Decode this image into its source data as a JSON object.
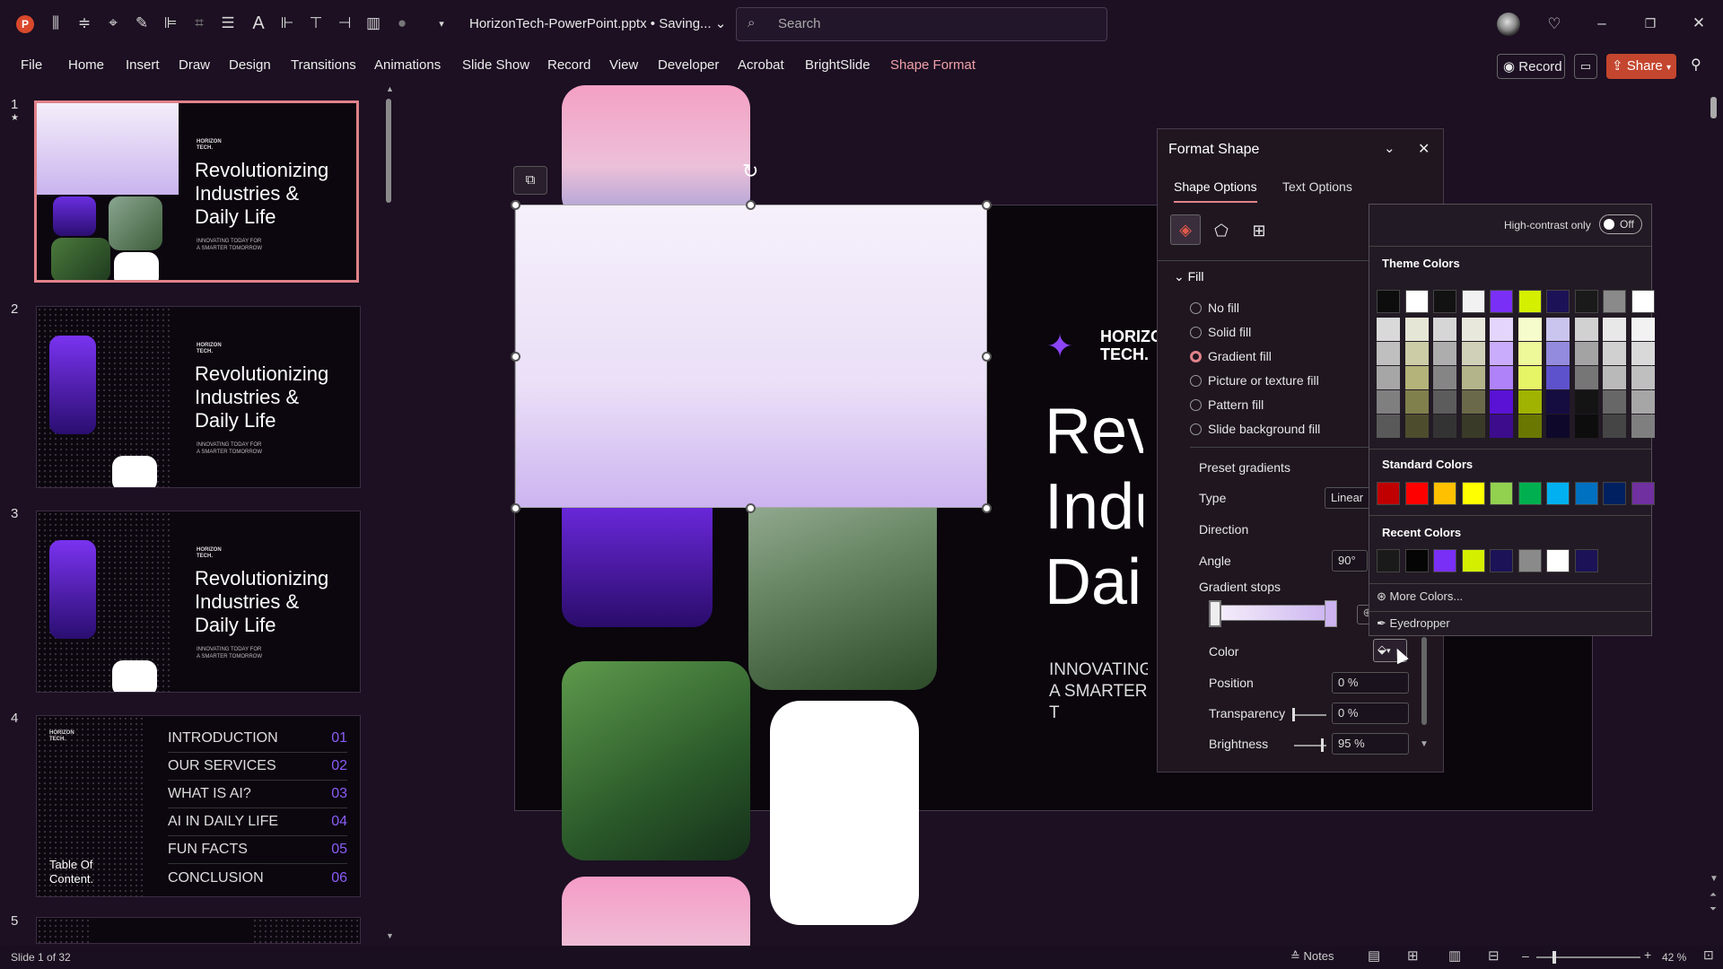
{
  "app": {
    "filename": "HorizonTech-PowerPoint.pptx",
    "status": "Saving...",
    "search_placeholder": "Search"
  },
  "ribbon_tabs": [
    "File",
    "Home",
    "Insert",
    "Draw",
    "Design",
    "Transitions",
    "Animations",
    "Slide Show",
    "Record",
    "View",
    "Developer",
    "Acrobat",
    "BrightSlide",
    "Shape Format"
  ],
  "active_tab": "Shape Format",
  "right_buttons": {
    "record": "Record",
    "share": "Share"
  },
  "thumbs": [
    {
      "num": "1",
      "title": "Revolutionizing\nIndustries &\nDaily Life",
      "sub": "INNOVATING TODAY FOR\nA SMARTER TOMORROW",
      "logo": "HORIZON\nTECH."
    },
    {
      "num": "2",
      "title": "Revolutionizing\nIndustries &\nDaily Life",
      "sub": "INNOVATING TODAY FOR\nA SMARTER TOMORROW",
      "logo": "HORIZON\nTECH."
    },
    {
      "num": "3",
      "title": "Revolutionizing\nIndustries &\nDaily Life",
      "sub": "INNOVATING TODAY FOR\nA SMARTER TOMORROW",
      "logo": "HORIZON\nTECH."
    }
  ],
  "toc": {
    "num": "4",
    "logo": "HORIZON\nTECH.",
    "label": "Table Of\nContent.",
    "items": [
      {
        "title": "INTRODUCTION",
        "n": "01"
      },
      {
        "title": "OUR SERVICES",
        "n": "02"
      },
      {
        "title": "WHAT IS AI?",
        "n": "03"
      },
      {
        "title": "AI IN DAILY LIFE",
        "n": "04"
      },
      {
        "title": "FUN FACTS",
        "n": "05"
      },
      {
        "title": "CONCLUSION",
        "n": "06"
      }
    ]
  },
  "thumb5": {
    "num": "5"
  },
  "slide": {
    "logo": "HORIZO\nTECH.",
    "title": "Revo\nIndu\nDaily",
    "sub": "INNOVATING\nA SMARTER T"
  },
  "format_shape": {
    "title": "Format Shape",
    "tab_shape": "Shape Options",
    "tab_text": "Text Options",
    "fill_header": "Fill",
    "fill_options": [
      "No fill",
      "Solid fill",
      "Gradient fill",
      "Picture or texture fill",
      "Pattern fill",
      "Slide background fill"
    ],
    "selected_fill": "Gradient fill",
    "preset_gradients": "Preset gradients",
    "type_label": "Type",
    "type_value": "Linear",
    "direction_label": "Direction",
    "angle_label": "Angle",
    "angle_value": "90°",
    "stops_label": "Gradient stops",
    "color_label": "Color",
    "position_label": "Position",
    "position_value": "0 %",
    "transparency_label": "Transparency",
    "transparency_value": "0 %",
    "brightness_label": "Brightness",
    "brightness_value": "95 %"
  },
  "color_popup": {
    "high_contrast": "High-contrast only",
    "toggle": "Off",
    "theme_header": "Theme Colors",
    "theme_top": [
      "#0d0d0d",
      "#ffffff",
      "#121212",
      "#f2f2f2",
      "#7a2ff7",
      "#d4ef00",
      "#1c1257",
      "#1a1a1a",
      "#8a8a8a",
      "#ffffff"
    ],
    "theme_shades": [
      [
        "#d9d9d9",
        "#bfbfbf",
        "#a6a6a6",
        "#7f7f7f",
        "#595959"
      ],
      [
        "#e6e6d6",
        "#cccca6",
        "#b3b37a",
        "#80804d",
        "#4d4d2e"
      ],
      [
        "#d6d6d6",
        "#adadad",
        "#858585",
        "#5c5c5c",
        "#333333"
      ],
      [
        "#e8e8dc",
        "#d0d0b8",
        "#b4b48a",
        "#6a6a4a",
        "#3a3a28"
      ],
      [
        "#e4d5fd",
        "#c9acfc",
        "#af82fa",
        "#5a12d4",
        "#3c0c8d"
      ],
      [
        "#f6fccc",
        "#eef999",
        "#e5f566",
        "#9fb300",
        "#6a7700"
      ],
      [
        "#c9c5ee",
        "#938bdd",
        "#5d52cc",
        "#150d40",
        "#0e092a"
      ],
      [
        "#d1d1d1",
        "#a3a3a3",
        "#767676",
        "#141414",
        "#0d0d0d"
      ],
      [
        "#e8e8e8",
        "#d0d0d0",
        "#b9b9b9",
        "#676767",
        "#454545"
      ],
      [
        "#f2f2f2",
        "#d9d9d9",
        "#bfbfbf",
        "#a6a6a6",
        "#7f7f7f"
      ]
    ],
    "standard_header": "Standard Colors",
    "standard": [
      "#c00000",
      "#ff0000",
      "#ffc000",
      "#ffff00",
      "#92d050",
      "#00b050",
      "#00b0f0",
      "#0070c0",
      "#002060",
      "#7030a0"
    ],
    "recent_header": "Recent Colors",
    "recent": [
      "#1a1a1a",
      "#050505",
      "#7a2ff7",
      "#d4ef00",
      "#1c1257",
      "#8a8a8a",
      "#ffffff",
      "#1c1257"
    ],
    "more_colors": "More Colors...",
    "eyedropper": "Eyedropper"
  },
  "status": {
    "slide_info": "Slide 1 of 32",
    "notes": "Notes",
    "zoom": "42 %"
  }
}
